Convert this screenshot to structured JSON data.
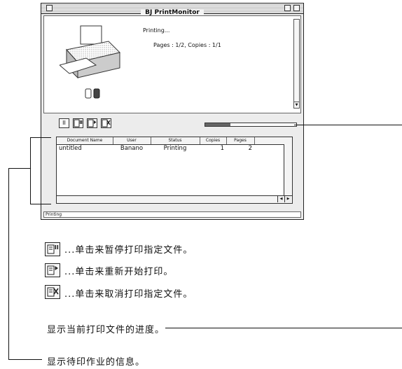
{
  "window": {
    "title": "BJ PrintMonitor",
    "status_message": "Printing...",
    "pages_copies": "Pages : 1/2, Copies : 1/1",
    "status_bar": "Printing"
  },
  "toolbar": {
    "pause_symbol": "II",
    "progress_fraction": 0.28
  },
  "job_list": {
    "columns": [
      "Document Name",
      "User",
      "Status",
      "Copies",
      "Pages"
    ],
    "rows": [
      {
        "document": "untitled",
        "user": "Banano",
        "status": "Printing",
        "copies": "1",
        "pages": "2"
      }
    ]
  },
  "explanations": {
    "pause": "...单击来暂停打印指定文件。",
    "resume": "...单击来重新开始打印。",
    "cancel": "...单击来取消打印指定文件。",
    "progress": "显示当前打印文件的进度。",
    "queue": "显示待印作业的信息。"
  },
  "icons": [
    "pause-document-icon",
    "resume-document-icon",
    "cancel-document-icon",
    "printer-icon",
    "ink-tank-icon"
  ]
}
